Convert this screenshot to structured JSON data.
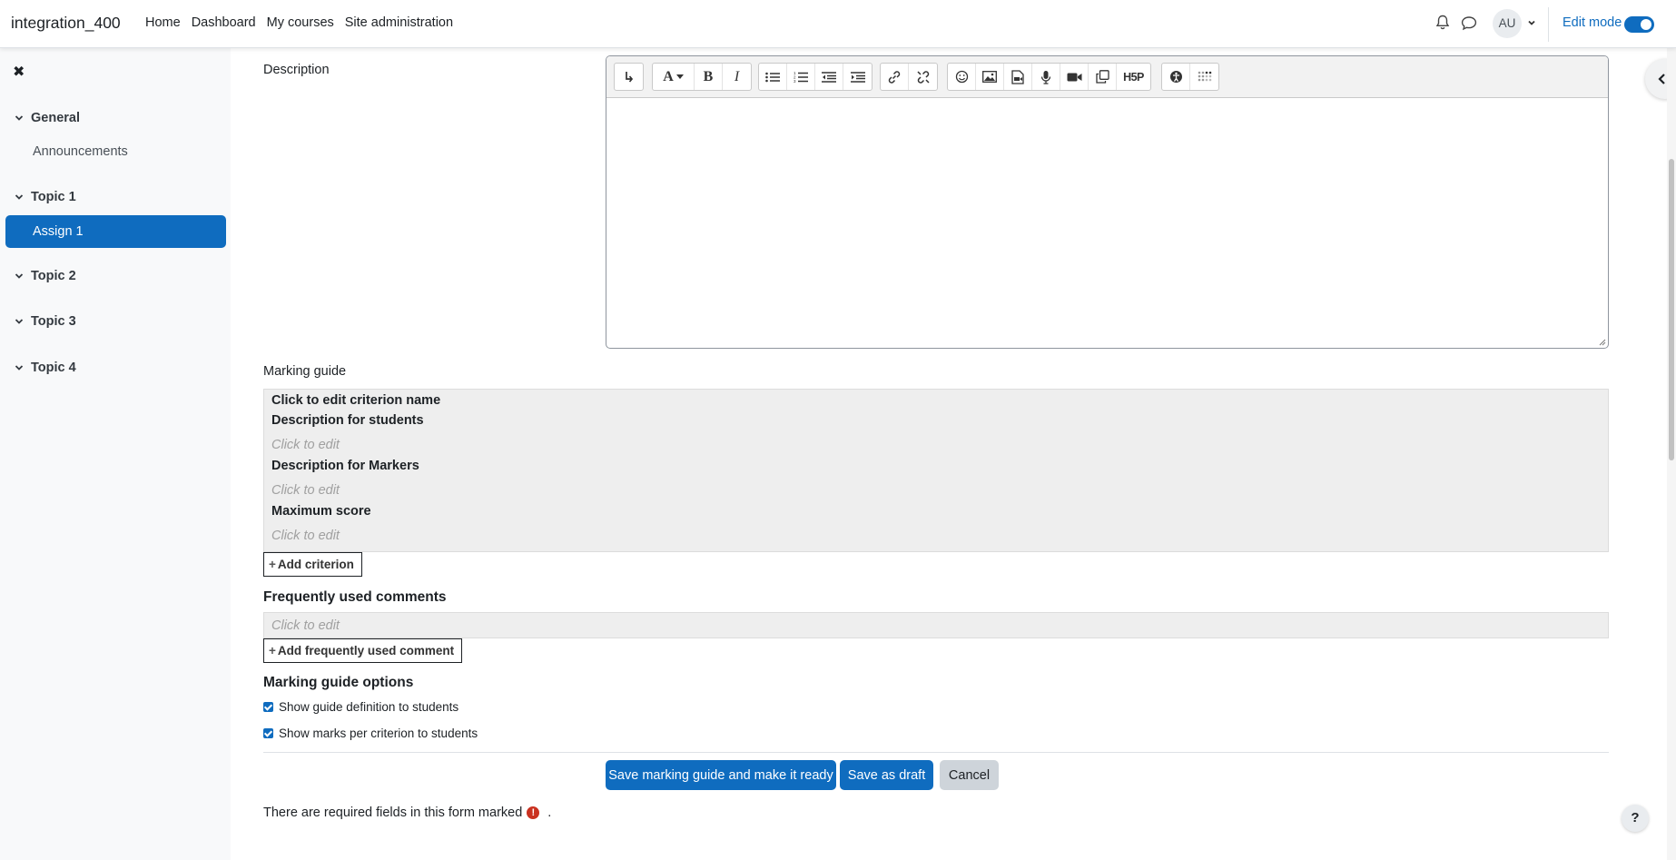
{
  "navbar": {
    "site_name": "integration_400",
    "links": [
      "Home",
      "Dashboard",
      "My courses",
      "Site administration"
    ],
    "avatar_initials": "AU",
    "edit_mode_label": "Edit mode",
    "edit_mode_on": true,
    "icons": [
      "bell-icon",
      "chat-icon",
      "chevron-down-icon"
    ]
  },
  "course_index": {
    "close_icon": "close-icon",
    "sections": [
      {
        "title": "General",
        "items": [
          "Announcements"
        ]
      },
      {
        "title": "Topic 1",
        "items": [
          "Assign 1"
        ]
      },
      {
        "title": "Topic 2",
        "items": []
      },
      {
        "title": "Topic 3",
        "items": []
      },
      {
        "title": "Topic 4",
        "items": []
      }
    ],
    "active_item": "Assign 1"
  },
  "form": {
    "description_label": "Description",
    "marking_guide_label": "Marking guide",
    "criterion": {
      "name_placeholder": "Click to edit criterion name",
      "desc_students_label": "Description for students",
      "desc_students_placeholder": "Click to edit",
      "desc_markers_label": "Description for Markers",
      "desc_markers_placeholder": "Click to edit",
      "max_score_label": "Maximum score",
      "max_score_placeholder": "Click to edit"
    },
    "add_criterion_label": "Add criterion",
    "frequent_comments_heading": "Frequently used comments",
    "frequent_comments_placeholder": "Click to edit",
    "add_comment_label": "Add frequently used comment",
    "options_heading": "Marking guide options",
    "options": [
      {
        "label": "Show guide definition to students",
        "checked": true
      },
      {
        "label": "Show marks per criterion to students",
        "checked": true
      }
    ],
    "buttons": {
      "save_ready": "Save marking guide and make it ready",
      "save_draft": "Save as draft",
      "cancel": "Cancel"
    },
    "required_note_text": "There are required fields in this form marked",
    "required_note_suffix": ".",
    "required_icon": "!"
  },
  "help_label": "?",
  "colors": {
    "primary": "#0f6cbf",
    "secondary": "#ced4da",
    "drawer_bg": "#f8f9fa",
    "guide_bg": "#eeeeee",
    "required": "#ca3120"
  }
}
